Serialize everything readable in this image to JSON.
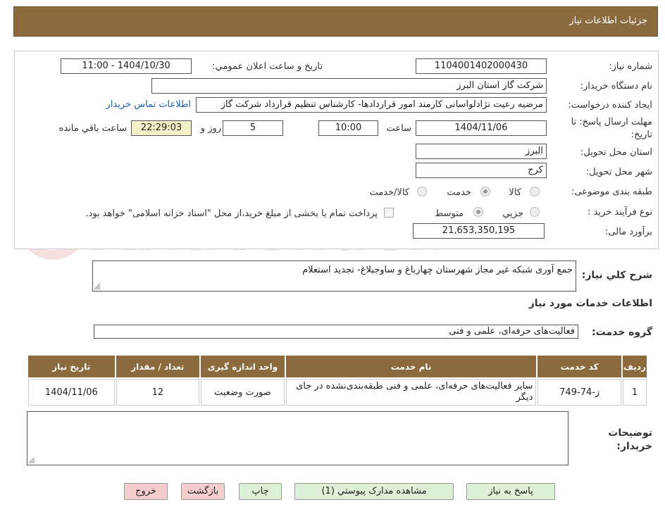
{
  "header": {
    "title": "جزئیات اطلاعات نیاز"
  },
  "form": {
    "need_number_label": "شماره نیاز:",
    "need_number": "1104001402000430",
    "announce_label": "تاریخ و ساعت اعلان عمومي:",
    "announce_value": "1404/10/30 - 11:00",
    "buyer_org_label": "نام دستگاه خريدار:",
    "buyer_org": "شرکت گاز استان البرز",
    "creator_label": "ايجاد کننده درخواست:",
    "creator": "مرضیه رعیت نژادلواسانی کارمند امور قراردادها- کارشناس تنظیم قرارداد شرکت گاز",
    "contact_link": "اطلاعات تماس خريدار",
    "deadline_label": "مهلت ارسال پاسخ: تا تاريخ:",
    "deadline_date": "1404/11/06",
    "time_label": "ساعت",
    "deadline_time": "10:00",
    "days": "5",
    "days_label": "روز و",
    "remaining": "22:29:03",
    "remaining_label": "ساعت باقي مانده",
    "province_label": "استان محل تحويل:",
    "province": "البرز",
    "city_label": "شهر محل تحويل:",
    "city": "کرج",
    "category_label": "طبقه بندی موضوعی:",
    "category_options": [
      "کالا",
      "خدمت",
      "کالا/خدمت"
    ],
    "process_label": "نوع فرآيند خريد :",
    "process_options": [
      "جزيي",
      "متوسط"
    ],
    "payment_note": "پرداخت تمام يا بخشی از مبلغ خريد،از محل \"اسناد خزانه اسلامی\" خواهد بود.",
    "budget_label": "برآورد مالی:",
    "budget": "21,653,350,195"
  },
  "summary": {
    "label": "شرح کلي نياز:",
    "value": "جمع آوری شبکه غیر مجاز شهرستان چهارباغ و ساوجبلاغ- تجدید استعلام"
  },
  "services": {
    "section_title": "اطلاعات خدمات مورد نياز",
    "group_label": "گروه خدمت:",
    "group_value": "فعاليت‌هاى حرفه‌اى، علمى و فنى",
    "columns": [
      "رديف",
      "کد خدمت",
      "نام خدمت",
      "واحد اندازه گيری",
      "تعداد / مقدار",
      "تاريخ نياز"
    ],
    "rows": [
      [
        "1",
        "ز-74-749",
        "ساير فعاليت‌هاى حرفه‌اى، علمى و فنى طبقه‌بندى‌نشده در جاى ديگر",
        "صورت وضعيت",
        "12",
        "1404/11/06"
      ]
    ]
  },
  "notes": {
    "label": "توضيحات خريدار:",
    "value": ""
  },
  "buttons": {
    "reply": "پاسخ به نياز",
    "attachments": "مشاهده مدارک پيوستي (1)",
    "print": "چاپ",
    "back": "بازگشت",
    "exit": "خروج"
  },
  "colors": {
    "header": "#8b6a3e",
    "remaining_bg": "#f4f0c8",
    "button_green": "#dff0d8",
    "button_pink": "#f6cdcd",
    "link": "#1a5fb4"
  }
}
